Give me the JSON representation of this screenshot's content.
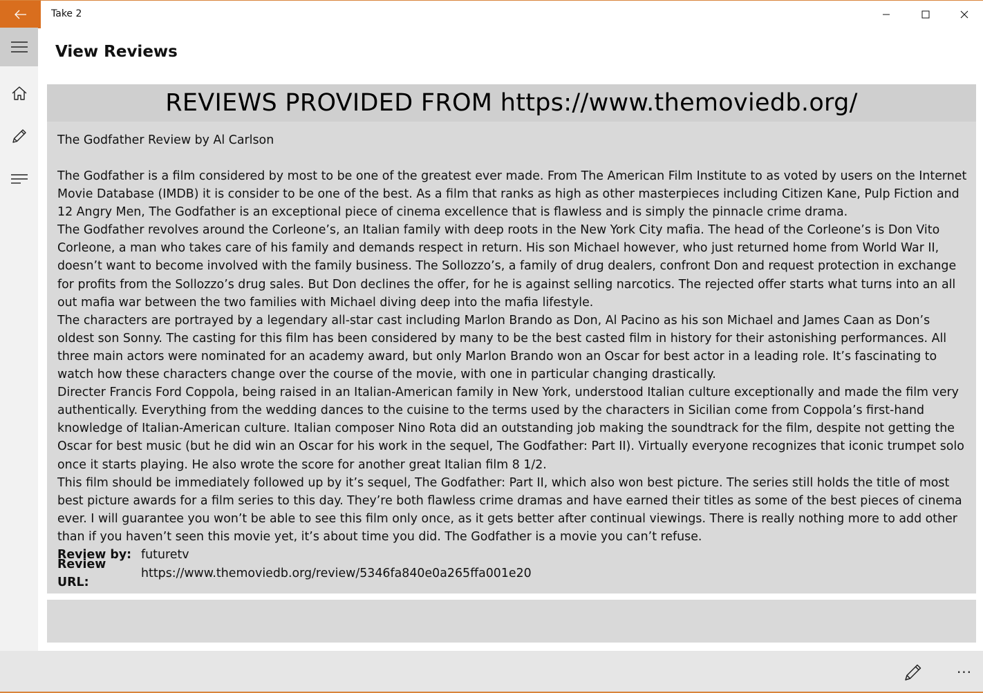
{
  "window": {
    "title": "Take 2",
    "accent_color": "#d96e1e"
  },
  "page": {
    "title": "View Reviews"
  },
  "sidebar": {
    "items": [
      {
        "icon": "home-icon"
      },
      {
        "icon": "pencil-icon"
      },
      {
        "icon": "list-icon"
      }
    ]
  },
  "review": {
    "banner": "REVIEWS PROVIDED FROM https://www.themoviedb.org/",
    "heading": "The Godfather Review by Al Carlson",
    "paragraphs": [
      "The Godfather is a film considered by most to be one of the greatest ever made. From The American Film Institute to as voted by users on the Internet Movie Database (IMDB) it is consider to be one of the best. As a film that ranks as high as other masterpieces including Citizen Kane, Pulp Fiction and 12 Angry Men, The Godfather is an exceptional piece of cinema excellence that is flawless and is simply the pinnacle crime drama.",
      "The Godfather revolves around the Corleone’s, an Italian family with deep roots in the New York City mafia. The head of the Corleone’s is Don Vito Corleone, a man who takes care of his family and demands respect in return. His son Michael however, who just returned home from World War II, doesn’t want to become involved with the family business. The Sollozzo’s, a family of drug dealers, confront Don and request protection in exchange for profits from the Sollozzo’s drug sales. But Don declines the offer, for he is against selling narcotics. The rejected offer starts what turns into an all out mafia war between the two families with Michael diving deep into the mafia lifestyle.",
      "The characters are portrayed by a legendary all-star cast including Marlon Brando as Don, Al Pacino as his son Michael and James Caan as Don’s oldest son Sonny. The casting for this film has been considered by many to be the best casted film in history for their astonishing performances. All three main actors were nominated for an academy award, but only Marlon Brando won an Oscar for best actor in a leading role. It’s fascinating to watch how these characters change over the course of the movie, with one in particular changing drastically.",
      "Directer Francis Ford Coppola, being raised in an Italian-American family in New York, understood Italian culture exceptionally and made the film very authentically. Everything from the wedding dances to the cuisine to the terms used by the characters in Sicilian come from Coppola’s first-hand knowledge of Italian-American culture. Italian composer Nino Rota did an outstanding job making the soundtrack for the film, despite not getting the Oscar for best music (but he did win an Oscar for his work in the sequel, The Godfather: Part II). Virtually everyone recognizes that iconic trumpet solo once it starts playing. He also wrote the score for another great Italian film 8 1/2.",
      "This film should be immediately followed up by it’s sequel, The Godfather: Part II, which also won best picture. The series still holds the title of most best picture awards for a film series to this day. They’re both flawless crime dramas and have earned their titles as some of the best pieces of cinema ever. I will guarantee you won’t be able to see this film only once, as it gets better after continual viewings. There is really nothing more to add other than if you haven’t seen this movie yet, it’s about time you did. The Godfather is a movie you can’t refuse."
    ],
    "review_by_label": "Review by:",
    "review_by_value": "futuretv",
    "review_url_label": "Review URL:",
    "review_url_value": "https://www.themoviedb.org/review/5346fa840e0a265ffa001e20"
  },
  "commandbar": {
    "edit_icon": "pencil-icon",
    "more_label": "···"
  }
}
